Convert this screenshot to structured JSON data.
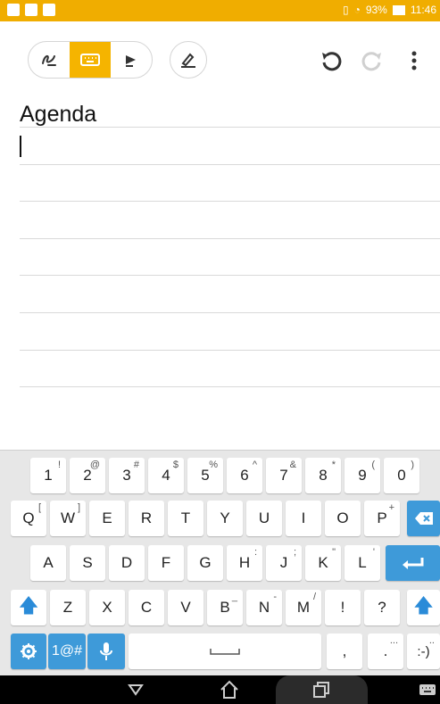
{
  "status": {
    "battery": "93%",
    "time": "11:46"
  },
  "note": {
    "title": "Agenda"
  },
  "keyboard": {
    "row1": [
      {
        "k": "1",
        "s": "!"
      },
      {
        "k": "2",
        "s": "@"
      },
      {
        "k": "3",
        "s": "#"
      },
      {
        "k": "4",
        "s": "$"
      },
      {
        "k": "5",
        "s": "%"
      },
      {
        "k": "6",
        "s": "^"
      },
      {
        "k": "7",
        "s": "&"
      },
      {
        "k": "8",
        "s": "*"
      },
      {
        "k": "9",
        "s": "("
      },
      {
        "k": "0",
        "s": ")"
      }
    ],
    "row2": [
      {
        "k": "Q",
        "s": "["
      },
      {
        "k": "W",
        "s": "]"
      },
      {
        "k": "E",
        "s": ""
      },
      {
        "k": "R",
        "s": ""
      },
      {
        "k": "T",
        "s": ""
      },
      {
        "k": "Y",
        "s": ""
      },
      {
        "k": "U",
        "s": ""
      },
      {
        "k": "I",
        "s": ""
      },
      {
        "k": "O",
        "s": ""
      },
      {
        "k": "P",
        "s": "+"
      }
    ],
    "row3": [
      {
        "k": "A",
        "s": ""
      },
      {
        "k": "S",
        "s": ""
      },
      {
        "k": "D",
        "s": ""
      },
      {
        "k": "F",
        "s": ""
      },
      {
        "k": "G",
        "s": ""
      },
      {
        "k": "H",
        "s": ":"
      },
      {
        "k": "J",
        "s": ";"
      },
      {
        "k": "K",
        "s": "\""
      },
      {
        "k": "L",
        "s": "'"
      }
    ],
    "row4": [
      {
        "k": "Z",
        "s": ""
      },
      {
        "k": "X",
        "s": ""
      },
      {
        "k": "C",
        "s": ""
      },
      {
        "k": "V",
        "s": ""
      },
      {
        "k": "B",
        "s": "_"
      },
      {
        "k": "N",
        "s": "-"
      },
      {
        "k": "M",
        "s": "/"
      },
      {
        "k": "!",
        "s": ""
      },
      {
        "k": "?",
        "s": ""
      }
    ],
    "sym_label": "1@#",
    "comma": ",",
    "period": ".",
    "period_sup": "...",
    "smiley": ":-)",
    "smiley_sup": ".."
  }
}
